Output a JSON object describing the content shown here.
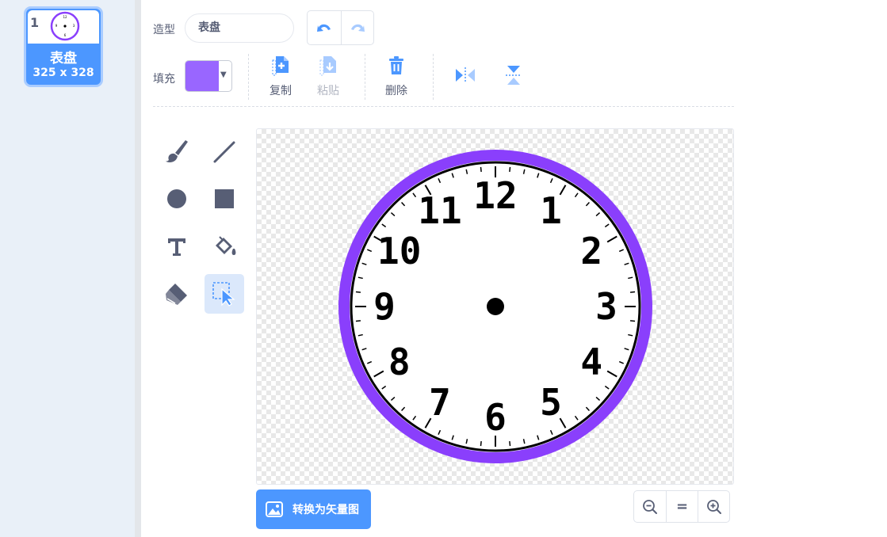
{
  "costume_list": {
    "items": [
      {
        "number": "1",
        "name": "表盘",
        "size": "325 x 328"
      }
    ]
  },
  "toolbar": {
    "costume_label": "造型",
    "costume_name_value": "表盘",
    "fill_label": "填充",
    "fill_color": "#9966ff",
    "copy_label": "复制",
    "paste_label": "粘贴",
    "delete_label": "删除"
  },
  "canvas": {
    "clock_numbers": [
      "12",
      "1",
      "2",
      "3",
      "4",
      "5",
      "6",
      "7",
      "8",
      "9",
      "10",
      "11"
    ],
    "ring_color": "#8a3ffc"
  },
  "footer": {
    "convert_label": "转换为矢量图",
    "zoom_reset_label": "="
  },
  "colors": {
    "accent": "#4c97ff",
    "icon_gray": "#575e75",
    "text_gray": "#575e75"
  }
}
